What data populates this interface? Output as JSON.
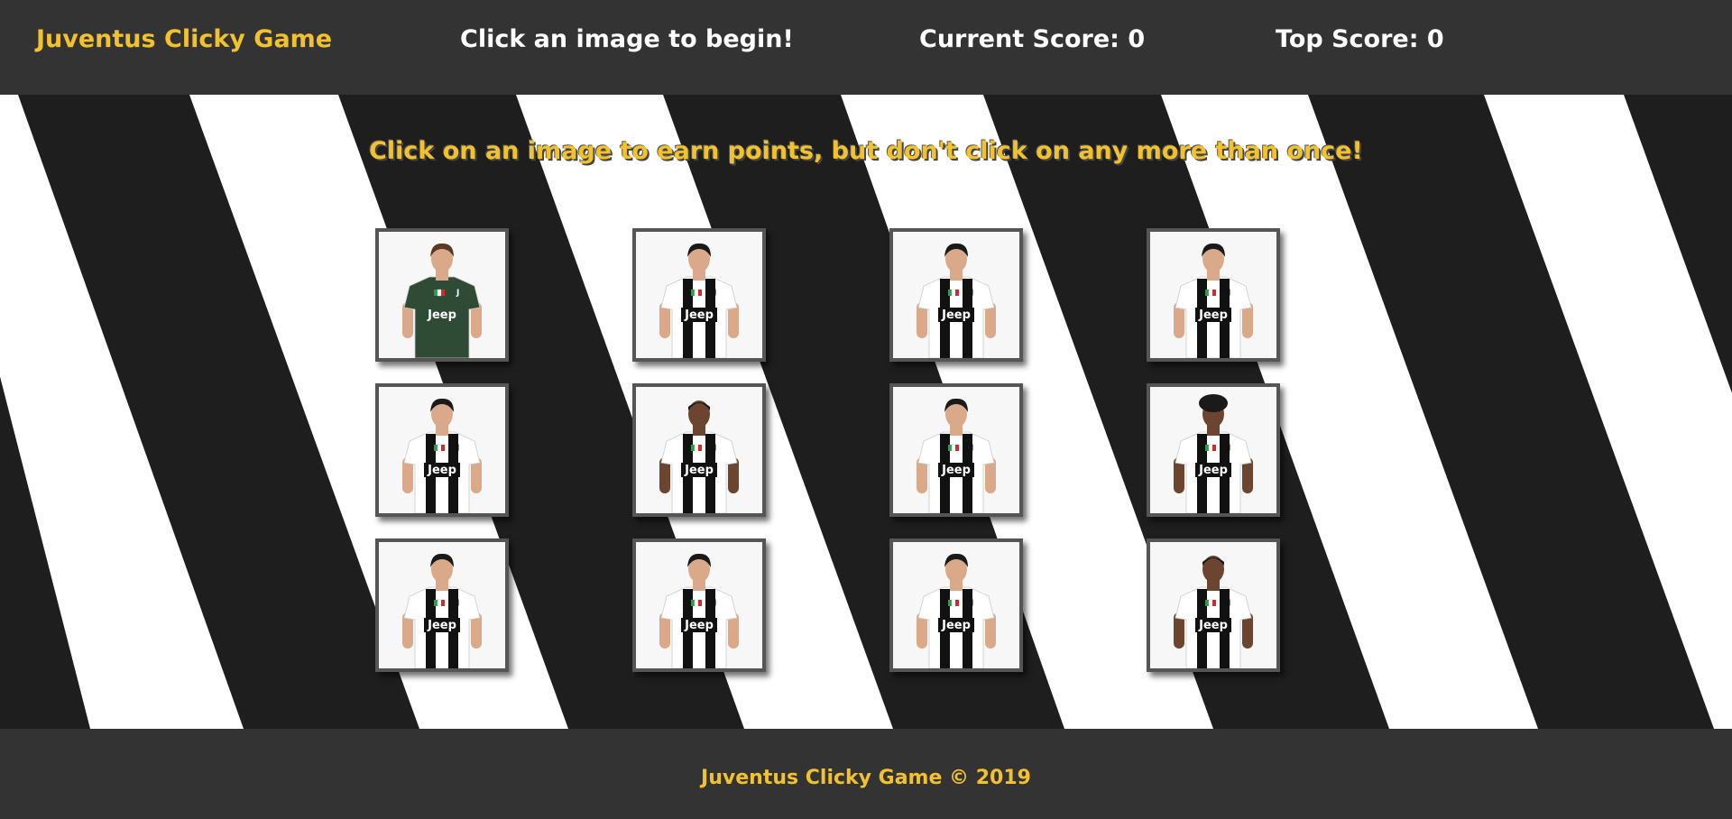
{
  "navbar": {
    "brand": "Juventus Clicky Game",
    "message": "Click an image to begin!",
    "current_score": "Current Score: 0",
    "top_score": "Top Score: 0"
  },
  "instructions": "Click on an image to earn points, but don't click on any more than once!",
  "footer": {
    "text": "Juventus Clicky Game © 2019"
  },
  "colors": {
    "accent": "#f2c12e",
    "navbar_bg": "#333333",
    "stripe_dark": "#1e1e1e",
    "stripe_light": "#ffffff",
    "goalkeeper_kit": "#2f4a35"
  },
  "cards": [
    {
      "kit": "goalkeeper",
      "sponsor": "Jeep",
      "hair": "short-brown"
    },
    {
      "kit": "home",
      "sponsor": "Jeep",
      "hair": "short-dark"
    },
    {
      "kit": "home",
      "sponsor": "Jeep",
      "hair": "short-dark"
    },
    {
      "kit": "home",
      "sponsor": "Jeep",
      "hair": "short-dark"
    },
    {
      "kit": "home",
      "sponsor": "Jeep",
      "hair": "short-dark"
    },
    {
      "kit": "home",
      "sponsor": "Jeep",
      "hair": "shaved-dark"
    },
    {
      "kit": "home",
      "sponsor": "Jeep",
      "hair": "short-dark"
    },
    {
      "kit": "home",
      "sponsor": "Jeep",
      "hair": "curly-dark"
    },
    {
      "kit": "home",
      "sponsor": "Jeep",
      "hair": "short-dark"
    },
    {
      "kit": "home",
      "sponsor": "Jeep",
      "hair": "short-dark"
    },
    {
      "kit": "home",
      "sponsor": "Jeep",
      "hair": "short-dark"
    },
    {
      "kit": "home",
      "sponsor": "Jeep",
      "hair": "shaved-dark"
    }
  ]
}
